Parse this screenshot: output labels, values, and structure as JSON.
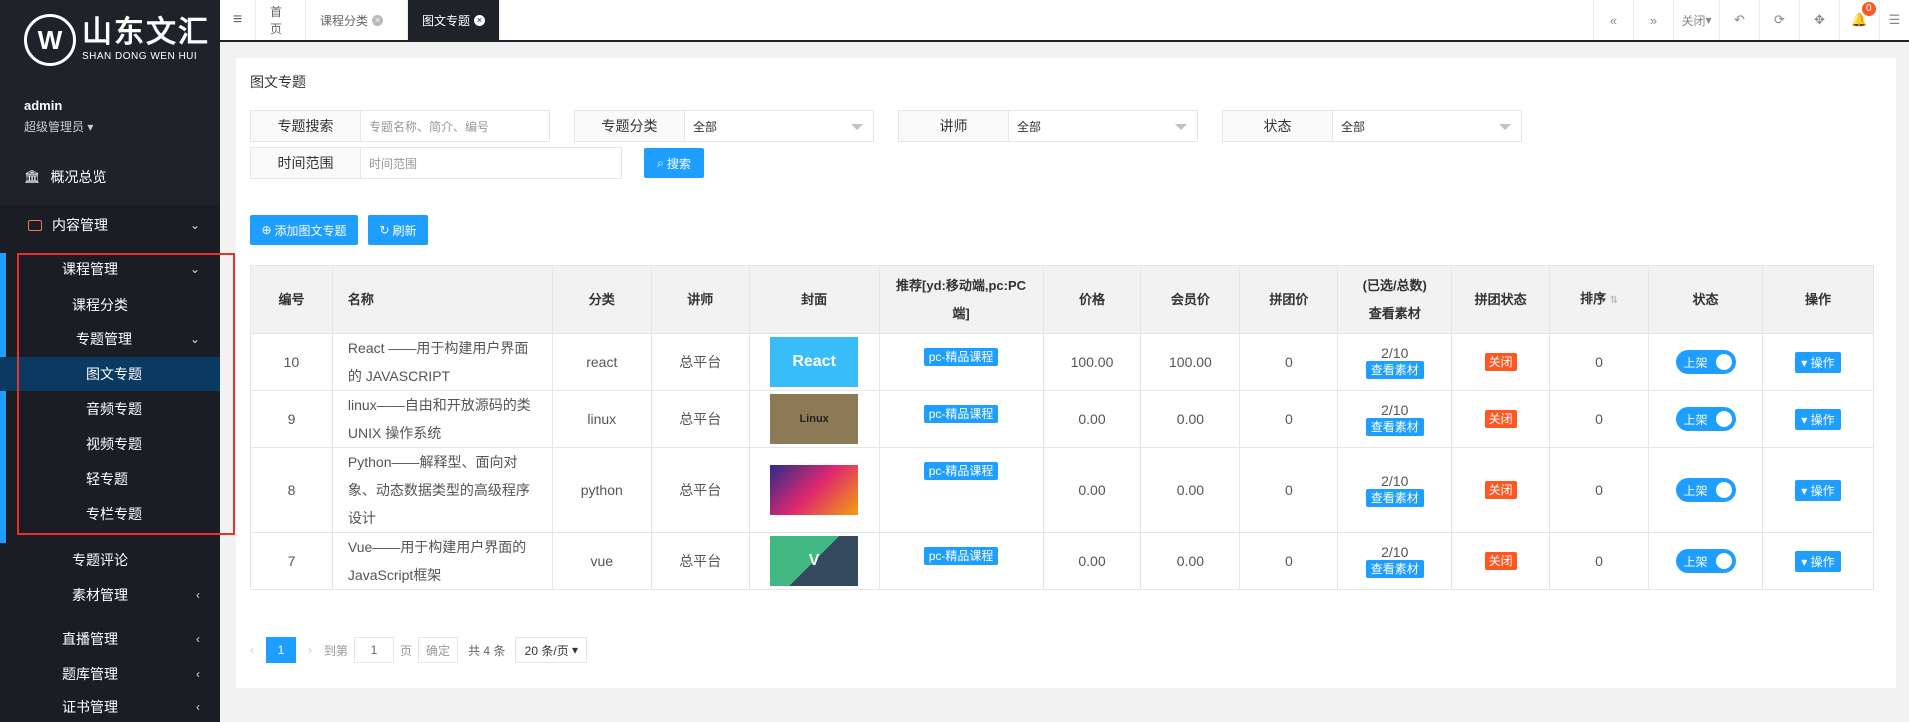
{
  "brand": {
    "cn": "山东文汇",
    "en": "SHAN DONG WEN HUI",
    "mark": "W"
  },
  "user": {
    "name": "admin",
    "role": "超级管理员"
  },
  "sidebar": {
    "overview": "概况总览",
    "content_mgmt": "内容管理",
    "course_mgmt": "课程管理",
    "course_category": "课程分类",
    "topic_mgmt": "专题管理",
    "topic_items": [
      "图文专题",
      "音频专题",
      "视频专题",
      "轻专题",
      "专栏专题"
    ],
    "topic_review": "专题评论",
    "material_mgmt": "素材管理",
    "live_mgmt": "直播管理",
    "question_mgmt": "题库管理",
    "cert_mgmt": "证书管理"
  },
  "tabs": {
    "home": "首页",
    "category": "课程分类",
    "current": "图文专题"
  },
  "toolbar": {
    "close": "关闭",
    "notifications": "0"
  },
  "page": {
    "title": "图文专题",
    "filters": {
      "search_label": "专题搜索",
      "search_placeholder": "专题名称、简介、编号",
      "category_label": "专题分类",
      "category_value": "全部",
      "teacher_label": "讲师",
      "teacher_value": "全部",
      "status_label": "状态",
      "status_value": "全部",
      "time_label": "时间范围",
      "time_placeholder": "时间范围",
      "search_btn": "搜索"
    },
    "actions": {
      "add": "添加图文专题",
      "refresh": "刷新"
    },
    "columns": {
      "id": "编号",
      "name": "名称",
      "category": "分类",
      "teacher": "讲师",
      "cover": "封面",
      "recommend": "推荐[yd:移动端,pc:PC端]",
      "price": "价格",
      "member_price": "会员价",
      "group_price": "拼团价",
      "material_line1": "(已选/总数)",
      "material_line2": "查看素材",
      "group_status": "拼团状态",
      "sort": "排序",
      "status": "状态",
      "operation": "操作"
    },
    "rows": [
      {
        "id": "10",
        "name": "React ——用于构建用户界面的 JAVASCRIPT",
        "category": "react",
        "teacher": "总平台",
        "cover": "React",
        "recommend": "pc-精品课程",
        "price": "100.00",
        "member_price": "100.00",
        "group_price": "0",
        "material": "2/10",
        "material_btn": "查看素材",
        "group_status": "关闭",
        "sort": "0",
        "status": "上架",
        "op": "操作"
      },
      {
        "id": "9",
        "name": "linux——自由和开放源码的类UNIX 操作系统",
        "category": "linux",
        "teacher": "总平台",
        "cover": "Linux",
        "recommend": "pc-精品课程",
        "price": "0.00",
        "member_price": "0.00",
        "group_price": "0",
        "material": "2/10",
        "material_btn": "查看素材",
        "group_status": "关闭",
        "sort": "0",
        "status": "上架",
        "op": "操作"
      },
      {
        "id": "8",
        "name": "Python——解释型、面向对象、动态数据类型的高级程序设计",
        "category": "python",
        "teacher": "总平台",
        "cover": "",
        "recommend": "pc-精品课程",
        "price": "0.00",
        "member_price": "0.00",
        "group_price": "0",
        "material": "2/10",
        "material_btn": "查看素材",
        "group_status": "关闭",
        "sort": "0",
        "status": "上架",
        "op": "操作"
      },
      {
        "id": "7",
        "name": "Vue——用于构建用户界面的JavaScript框架",
        "category": "vue",
        "teacher": "总平台",
        "cover": "V",
        "recommend": "pc-精品课程",
        "price": "0.00",
        "member_price": "0.00",
        "group_price": "0",
        "material": "2/10",
        "material_btn": "查看素材",
        "group_status": "关闭",
        "sort": "0",
        "status": "上架",
        "op": "操作"
      }
    ],
    "pager": {
      "current": "1",
      "goto": "到第",
      "page_input": "1",
      "page_unit": "页",
      "confirm": "确定",
      "total": "共 4 条",
      "per_page": "20 条/页"
    }
  },
  "colors": {
    "accent": "#1e9fff",
    "sidebar": "#20222a",
    "danger": "#ff5722",
    "highlight_box": "#e8302e"
  }
}
